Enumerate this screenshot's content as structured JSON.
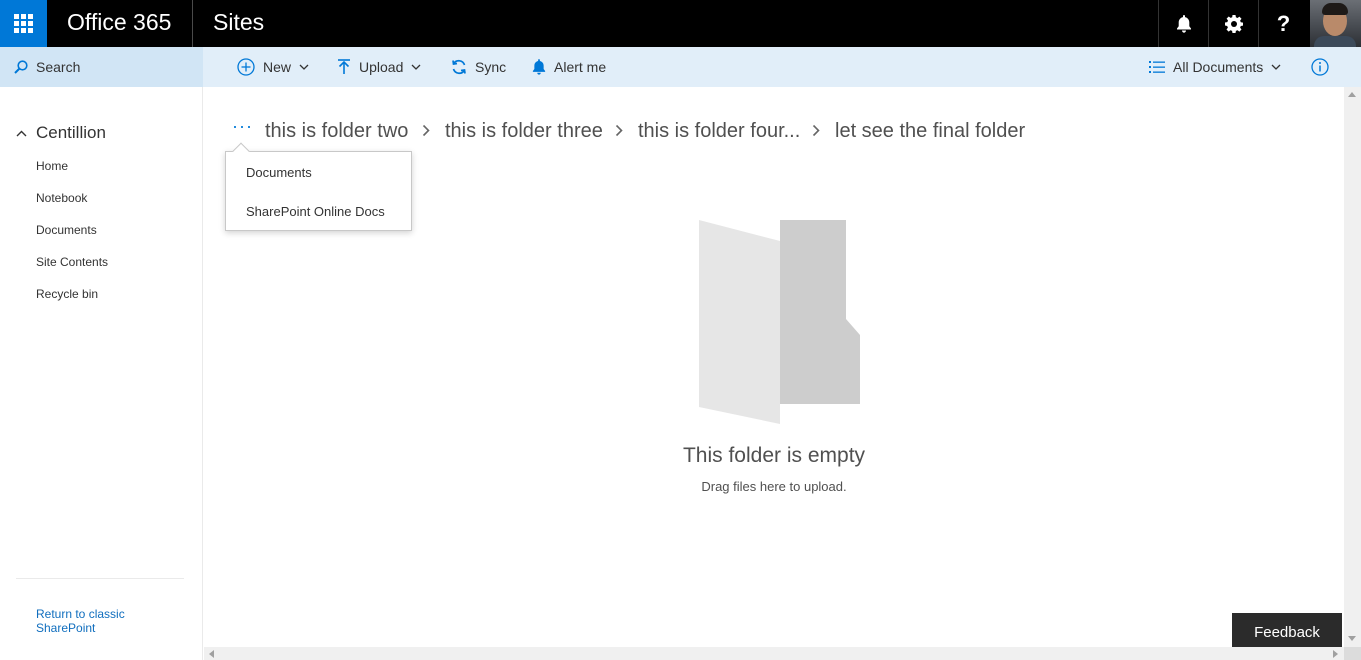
{
  "suite": {
    "brand": "Office 365",
    "app_title": "Sites",
    "help_label": "?"
  },
  "commandbar": {
    "search_label": "Search",
    "new_label": "New",
    "upload_label": "Upload",
    "sync_label": "Sync",
    "alert_label": "Alert me",
    "view_label": "All Documents"
  },
  "leftnav": {
    "site_name": "Centillion",
    "items": [
      {
        "label": "Home"
      },
      {
        "label": "Notebook"
      },
      {
        "label": "Documents"
      },
      {
        "label": "Site Contents"
      },
      {
        "label": "Recycle bin"
      }
    ],
    "classic_link": "Return to classic SharePoint"
  },
  "breadcrumb": {
    "ellipsis": "···",
    "items": [
      {
        "label": "this is folder two"
      },
      {
        "label": "this is folder three"
      },
      {
        "label": "this is folder four..."
      },
      {
        "label": "let see the final folder"
      }
    ],
    "overflow_items": [
      {
        "label": "Documents"
      },
      {
        "label": "SharePoint Online Docs"
      }
    ]
  },
  "empty_state": {
    "title": "This folder is empty",
    "subtitle": "Drag files here to upload."
  },
  "feedback_label": "Feedback",
  "colors": {
    "accent": "#0078d7",
    "suitebar": "#000000",
    "commandbar": "#e1eef9",
    "search_bg": "#d1e5f5",
    "link": "#106ebe"
  }
}
